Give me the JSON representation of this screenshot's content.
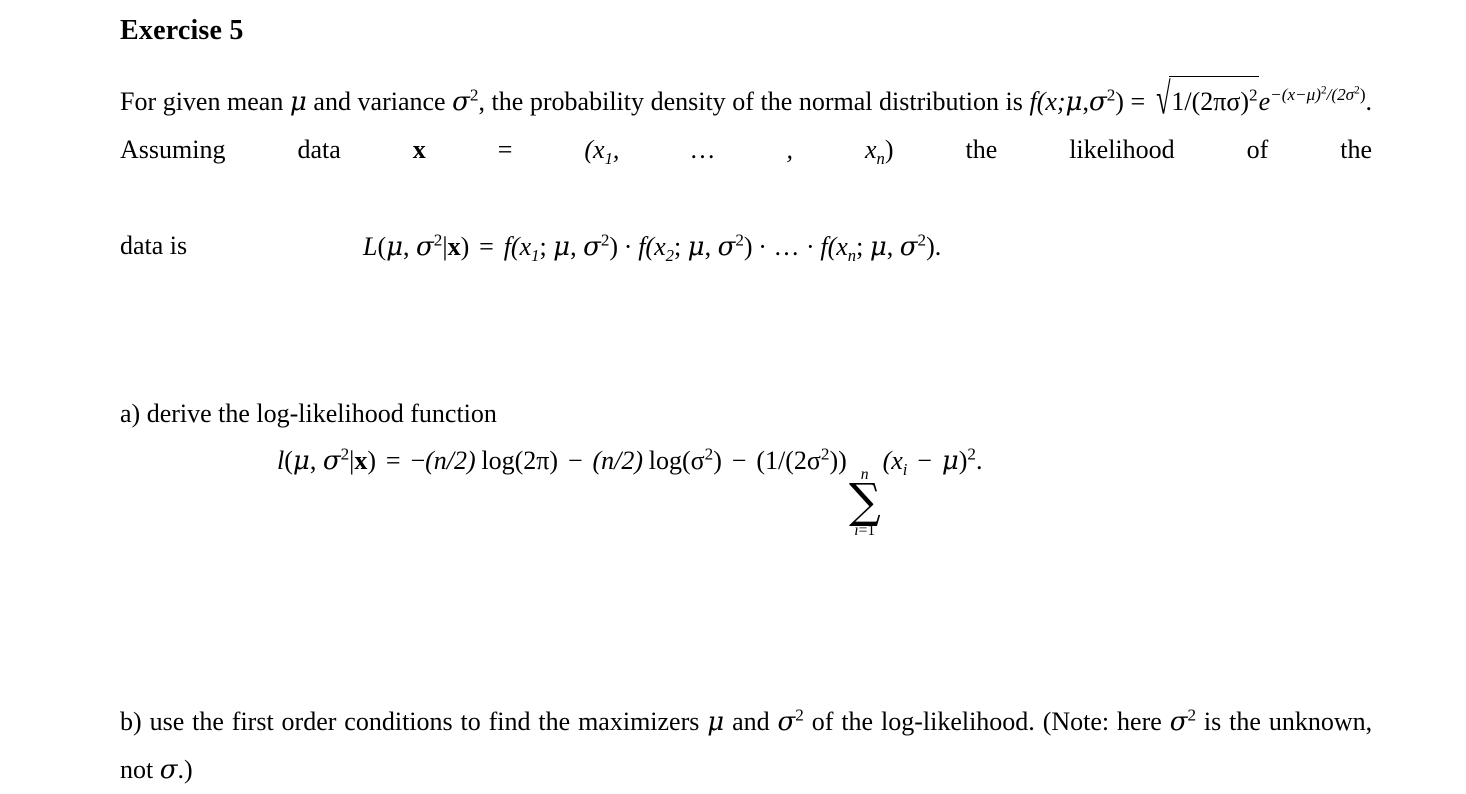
{
  "document": {
    "title": "Exercise 5",
    "background_color": "#ffffff",
    "text_color": "#000000"
  },
  "intro": {
    "s1": "For given mean",
    "mu": "μ",
    "s2": "and variance",
    "sigma": "σ",
    "exp2": "2",
    "s3": ", the probability density of the normal distribution is",
    "density_lhs_f": "f",
    "density_lhs_args": "(x;",
    "density_lhs_comma": ",",
    "density_lhs_close": ")",
    "equals": "=",
    "radical": "√",
    "radicand": "1/(2πσ)",
    "radicand_exp": "2",
    "e": "e",
    "exponent_prefix": "−(x−μ)",
    "exponent_num_exp": "2",
    "exponent_div": "/(2σ",
    "exponent_den_exp": "2",
    "exponent_close": ")",
    "period": ".",
    "s4": "Assuming data",
    "bold_x": "x",
    "vector_eq": "=",
    "vector_open": "(x",
    "vector_sub1": "1",
    "vector_dots": ", … , x",
    "vector_subn": "n",
    "vector_close": ")",
    "s5": "the likelihood of the",
    "s6": "data is"
  },
  "equation_likelihood": {
    "lhs_l": "L",
    "lhs_open": "(",
    "lhs_mu": "μ",
    "lhs_comma": ", ",
    "lhs_sigma": "σ",
    "lhs_exp": "2",
    "lhs_bar": "|",
    "lhs_x": "x",
    "lhs_close": ")",
    "equals": "=",
    "t1_f": "f",
    "t1_args": "(x",
    "t1_sub": "1",
    "t1_semi": "; ",
    "t1_mu": "μ",
    "t1_comma": ", ",
    "t1_sigma": "σ",
    "t1_exp": "2",
    "t1_close": ")",
    "dot1": "·",
    "t2_sub": "2",
    "dot2": "· … ·",
    "t3_sub": "n",
    "period": "."
  },
  "part_a": {
    "label": "a)",
    "text": "derive the log-likelihood function"
  },
  "equation_loglik": {
    "lhs_l": "l",
    "lhs_open": "(",
    "lhs_mu": "μ",
    "lhs_comma": ", ",
    "lhs_sigma": "σ",
    "lhs_exp": "2",
    "lhs_bar": "|",
    "lhs_x": "x",
    "lhs_close": ")",
    "equals": "=",
    "term1_sign": "−",
    "term1_frac": "(n/2)",
    "term1_log": "log(2π)",
    "minus1": "−",
    "term2_frac": "(n/2)",
    "term2_log_open": "log(σ",
    "term2_log_exp": "2",
    "term2_log_close": ")",
    "minus2": "−",
    "term3_coef_open": "(1/(2σ",
    "term3_coef_exp": "2",
    "term3_coef_close": "))",
    "sum_glyph": "∑",
    "sum_upper": "n",
    "sum_lower_i": "i",
    "sum_lower_eq": "=",
    "sum_lower_1": "1",
    "sum_body_open": "(x",
    "sum_body_sub": "i",
    "sum_body_minus": "−",
    "sum_body_mu": "μ",
    "sum_body_close": ")",
    "sum_body_exp": "2",
    "period": "."
  },
  "part_b": {
    "label": "b)",
    "text1": "use the first order conditions to find the maximizers",
    "mu": "μ",
    "text2": "and",
    "sigma": "σ",
    "sigma_exp": "2",
    "text3": "of the log-likelihood. (Note:",
    "text4": "here",
    "sigma2": "σ",
    "sigma2_exp": "2",
    "text5": "is the unknown, not",
    "sigma3": "σ",
    "text6": ".)"
  }
}
